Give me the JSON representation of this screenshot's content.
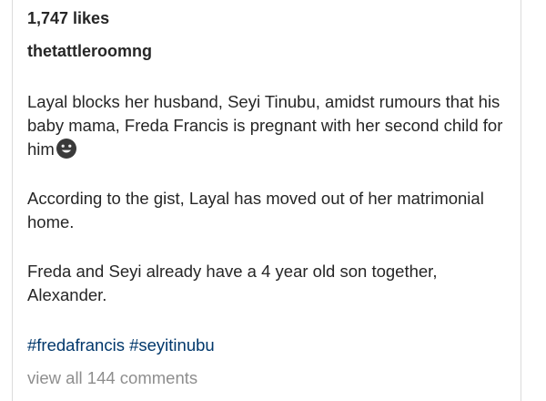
{
  "post": {
    "likes_text": "1,747 likes",
    "username": "thetattleroomng",
    "caption_paragraphs": [
      "Layal blocks her husband, Seyi Tinubu, amidst rumours that his baby mama, Freda Francis is pregnant with her second child for him",
      "According to the gist, Layal has moved out of her matrimonial home.",
      "Freda and Seyi already have a 4 year old son together, Alexander."
    ],
    "emoji_icon": "grinning-face-icon",
    "hashtags": [
      "#fredafrancis",
      "#seyitinubu"
    ],
    "view_comments_text": "view all 144 comments"
  },
  "colors": {
    "text": "#262626",
    "link": "#00376b",
    "muted": "#8e8e8e",
    "border": "#dbdbdb"
  }
}
